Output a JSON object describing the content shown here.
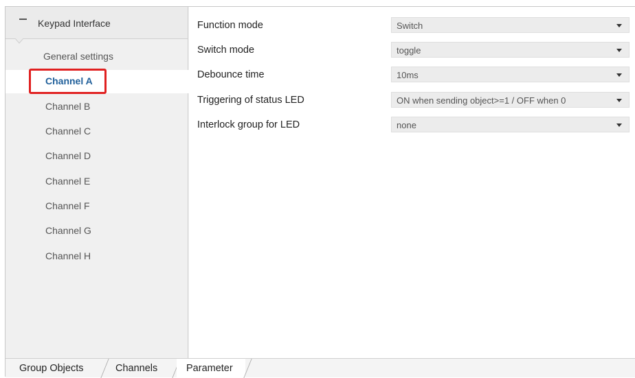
{
  "tree": {
    "root_label": "Keypad Interface",
    "items": [
      {
        "label": "General settings"
      },
      {
        "label": "Channel A",
        "selected": true
      },
      {
        "label": "Channel B"
      },
      {
        "label": "Channel C"
      },
      {
        "label": "Channel D"
      },
      {
        "label": "Channel E"
      },
      {
        "label": "Channel F"
      },
      {
        "label": "Channel G"
      },
      {
        "label": "Channel H"
      }
    ]
  },
  "parameters": [
    {
      "label": "Function mode",
      "value": "Switch"
    },
    {
      "label": "Switch mode",
      "value": "toggle"
    },
    {
      "label": "Debounce time",
      "value": "10ms"
    },
    {
      "label": "Triggering of status LED",
      "value": "ON when sending object>=1 / OFF when 0"
    },
    {
      "label": "Interlock group for LED",
      "value": "none"
    }
  ],
  "tabs": [
    {
      "label": "Group Objects"
    },
    {
      "label": "Channels"
    },
    {
      "label": "Parameter",
      "active": true
    }
  ],
  "colors": {
    "selected_text": "#1f5f9a",
    "highlight_box": "#e02020"
  }
}
